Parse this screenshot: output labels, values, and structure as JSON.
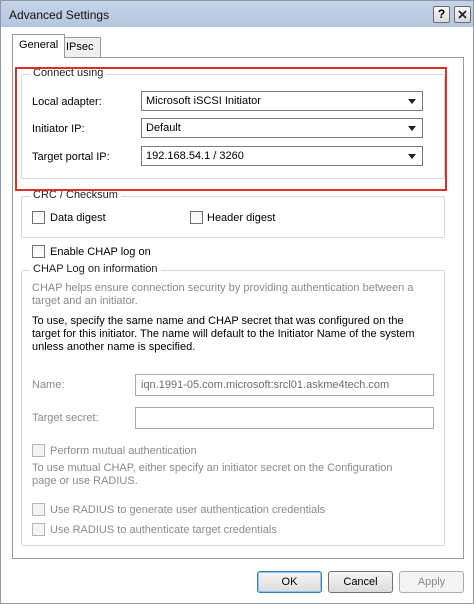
{
  "window": {
    "title": "Advanced Settings",
    "help_label": "?"
  },
  "tabs": [
    {
      "label": "General"
    },
    {
      "label": "IPsec"
    }
  ],
  "connect": {
    "legend": "Connect using",
    "local_adapter_label": "Local adapter:",
    "local_adapter_value": "Microsoft iSCSI Initiator",
    "initiator_ip_label": "Initiator IP:",
    "initiator_ip_value": "Default",
    "target_portal_label": "Target portal IP:",
    "target_portal_value": "192.168.54.1 / 3260"
  },
  "crc": {
    "legend": "CRC / Checksum",
    "data_digest": "Data digest",
    "header_digest": "Header digest"
  },
  "chap": {
    "enable_label": "Enable CHAP log on",
    "legend": "CHAP Log on information",
    "help_text": "CHAP helps ensure connection security by providing authentication between a target and an initiator.",
    "instructions": "To use, specify the same name and CHAP secret that was configured on the target for this initiator.  The name will default to the Initiator Name of the system unless another name is specified.",
    "name_label": "Name:",
    "name_value": "iqn.1991-05.com.microsoft:srcl01.askme4tech.com",
    "secret_label": "Target secret:",
    "secret_value": "",
    "mutual_label": "Perform mutual authentication",
    "mutual_help": "To use mutual CHAP, either specify an initiator secret on the Configuration page or use RADIUS.",
    "radius_user_label": "Use RADIUS to generate user authentication credentials",
    "radius_target_label": "Use RADIUS to authenticate target credentials"
  },
  "buttons": {
    "ok": "OK",
    "cancel": "Cancel",
    "apply": "Apply"
  },
  "colors": {
    "highlight": "#d9302a",
    "titlebar": "#c5d4e8"
  }
}
